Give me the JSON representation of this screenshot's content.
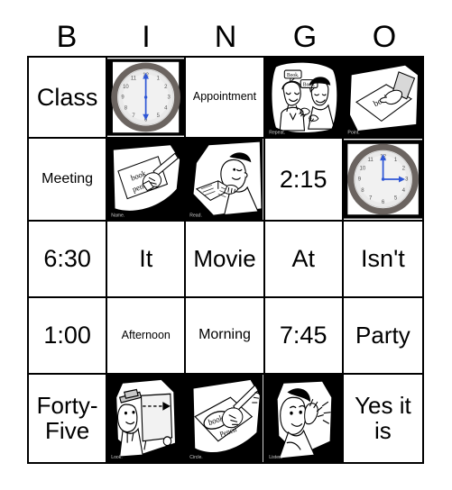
{
  "card": {
    "title": "BINGO",
    "header_letters": [
      "B",
      "I",
      "N",
      "G",
      "O"
    ],
    "columns": 5,
    "rows": 5
  },
  "cells": [
    [
      {
        "type": "text",
        "value": "Class",
        "size": "xl"
      },
      {
        "type": "image",
        "icon": "analog-clock-icon",
        "caption": "",
        "clock": {
          "hour": 6,
          "minute": 0,
          "hand_color": "#2f57d6"
        }
      },
      {
        "type": "text",
        "value": "Appointment",
        "size": "sm"
      },
      {
        "type": "image",
        "icon": "two-people-speaking-icon",
        "caption": "Repeat.",
        "background": "black",
        "speech_bubbles": [
          "Book.",
          "Book."
        ]
      },
      {
        "type": "image",
        "icon": "hand-pointing-at-paper-icon",
        "caption": "Point.",
        "background": "black",
        "paper_text": "book"
      }
    ],
    [
      {
        "type": "text",
        "value": "Meeting",
        "size": "md"
      },
      {
        "type": "image",
        "icon": "hand-writing-name-on-paper-icon",
        "caption": "Name.",
        "background": "black",
        "paper_text": "book pencil"
      },
      {
        "type": "image",
        "icon": "person-reading-book-icon",
        "caption": "Read.",
        "background": "black"
      },
      {
        "type": "text",
        "value": "2:15",
        "size": "xl"
      },
      {
        "type": "image",
        "icon": "analog-clock-icon",
        "caption": "",
        "clock": {
          "hour": 3,
          "minute": 0,
          "hand_color": "#2f57d6"
        }
      }
    ],
    [
      {
        "type": "text",
        "value": "6:30",
        "size": "xl"
      },
      {
        "type": "text",
        "value": "It",
        "size": "xl"
      },
      {
        "type": "text",
        "value": "Movie",
        "size": "lg"
      },
      {
        "type": "text",
        "value": "At",
        "size": "xl"
      },
      {
        "type": "text",
        "value": "Isn't",
        "size": "xl"
      }
    ],
    [
      {
        "type": "text",
        "value": "1:00",
        "size": "xl"
      },
      {
        "type": "text",
        "value": "Afternoon",
        "size": "sm"
      },
      {
        "type": "text",
        "value": "Morning",
        "size": "md"
      },
      {
        "type": "text",
        "value": "7:45",
        "size": "xl"
      },
      {
        "type": "text",
        "value": "Party",
        "size": "lg"
      }
    ],
    [
      {
        "type": "text",
        "value": "Forty-Five",
        "size": "lg"
      },
      {
        "type": "image",
        "icon": "person-looking-at-board-icon",
        "caption": "Look.",
        "background": "black"
      },
      {
        "type": "image",
        "icon": "hand-circling-word-icon",
        "caption": "Circle.",
        "background": "black",
        "paper_text": "book Pencil"
      },
      {
        "type": "image",
        "icon": "person-listening-icon",
        "caption": "Listen.",
        "background": "black"
      },
      {
        "type": "text",
        "value": "Yes it is",
        "size": "lg"
      }
    ]
  ],
  "colors": {
    "grid_line": "#000000",
    "background": "#ffffff",
    "text": "#000000",
    "clock_hand": "#2f57d6",
    "clock_rim": "#6b6460"
  }
}
